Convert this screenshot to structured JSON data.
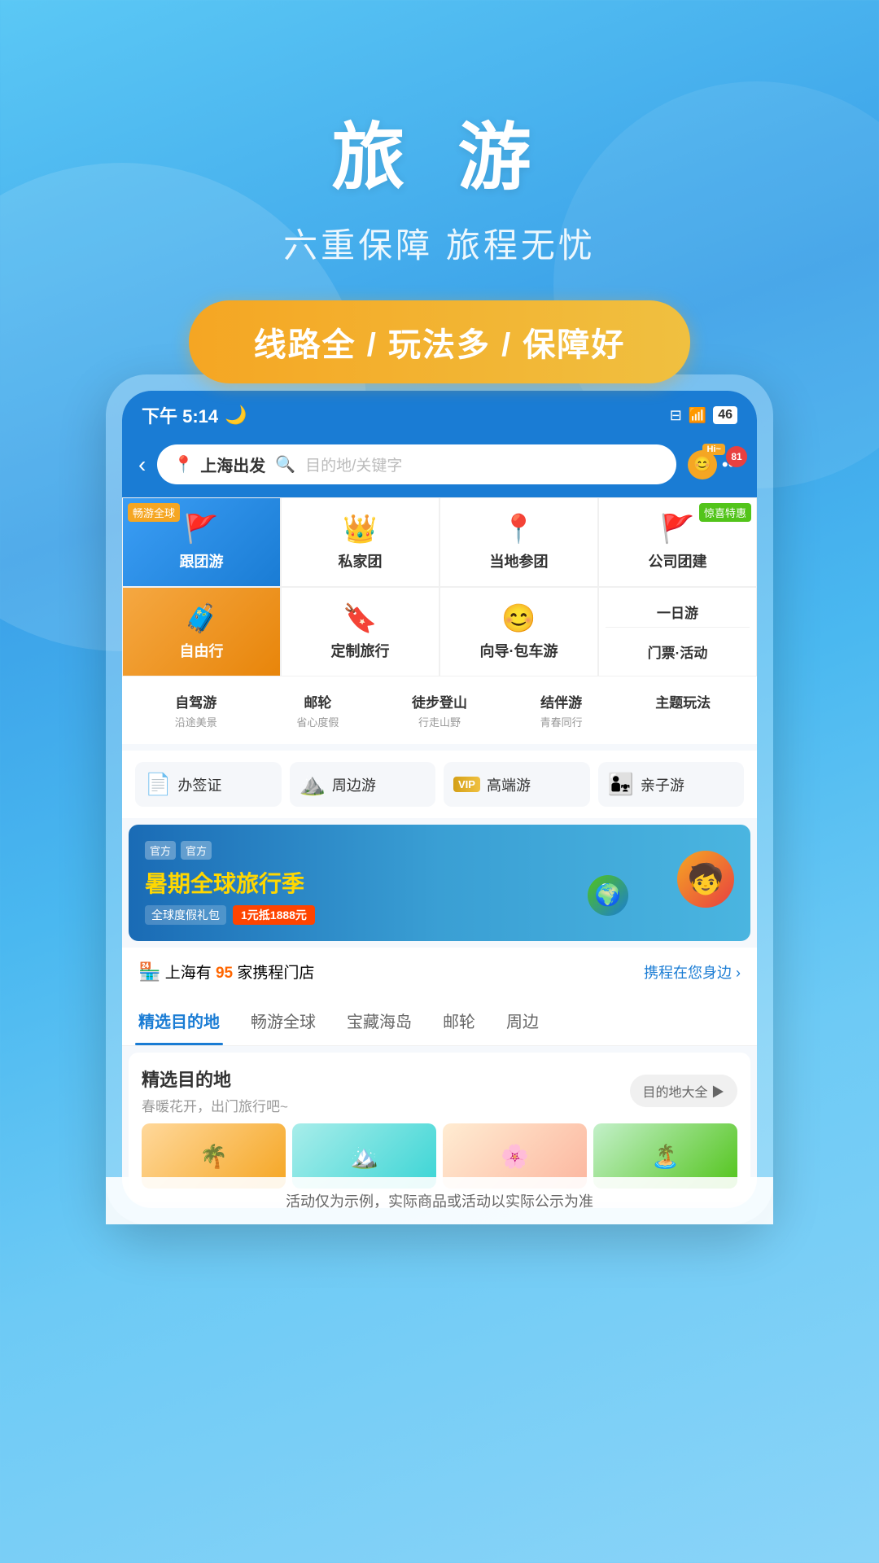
{
  "hero": {
    "title": "旅 游",
    "subtitle": "六重保障 旅程无忧",
    "badge": "线路全 / 玩法多 / 保障好"
  },
  "statusBar": {
    "time": "下午 5:14",
    "moonIcon": "🌙"
  },
  "searchBar": {
    "backIcon": "‹",
    "originLabel": "上海出发",
    "destinationPlaceholder": "目的地/关键字",
    "hiBadge": "Hi~",
    "notificationCount": "81"
  },
  "grid": {
    "row1": [
      {
        "label": "跟团游",
        "tag": "畅游全球",
        "icon": "🚩",
        "type": "blue"
      },
      {
        "label": "私家团",
        "icon": "👑",
        "type": "normal"
      },
      {
        "label": "当地参团",
        "icon": "📍",
        "type": "normal"
      },
      {
        "label": "公司团建",
        "tag": "惊喜特惠",
        "icon": "🚩",
        "type": "normal"
      }
    ],
    "row2": [
      {
        "label": "自由行",
        "icon": "🧳",
        "type": "orange"
      },
      {
        "label": "定制旅行",
        "icon": "🔖",
        "type": "normal"
      },
      {
        "label": "向导·包车游",
        "icon": "💋",
        "type": "normal"
      },
      {
        "label1": "一日游",
        "label2": "门票·活动",
        "type": "split"
      }
    ]
  },
  "subCategories": [
    {
      "label": "自驾游",
      "desc": "沿途美景"
    },
    {
      "label": "邮轮",
      "desc": "省心度假"
    },
    {
      "label": "徒步登山",
      "desc": "行走山野"
    },
    {
      "label": "结伴游",
      "desc": "青春同行"
    },
    {
      "label": "主题玩法",
      "desc": ""
    }
  ],
  "quickAccess": [
    {
      "label": "办签证",
      "icon": "📄"
    },
    {
      "label": "周边游",
      "icon": "⛰️"
    },
    {
      "label": "高端游",
      "icon": "VIP"
    },
    {
      "label": "亲子游",
      "icon": "👨‍👧"
    }
  ],
  "banner": {
    "tag1": "官方",
    "tag2": "官方",
    "title": "暑期全球旅行季",
    "subtitle": "全球度假礼包",
    "promo": "1元抵1888元"
  },
  "storeInfo": {
    "prefix": "上海有",
    "count": "95",
    "suffix": "家携程门店",
    "link": "携程在您身边 ›"
  },
  "tabs": [
    {
      "label": "精选目的地",
      "active": true
    },
    {
      "label": "畅游全球",
      "active": false
    },
    {
      "label": "宝藏海岛",
      "active": false
    },
    {
      "label": "邮轮",
      "active": false
    },
    {
      "label": "周边",
      "active": false
    }
  ],
  "featuredSection": {
    "title": "精选目的地",
    "subtitle": "春暖花开，出门旅行吧~",
    "seeAllBtn": "目的地大全 ▶"
  },
  "disclaimer": {
    "text": "活动仅为示例，实际商品或活动以实际公示为准"
  },
  "colors": {
    "primary": "#1a7cd4",
    "orange": "#f5a623",
    "blue_gradient_start": "#3b9ef5",
    "blue_gradient_end": "#1a7cd4",
    "orange_gradient_start": "#f5a842",
    "orange_gradient_end": "#e8850a"
  }
}
